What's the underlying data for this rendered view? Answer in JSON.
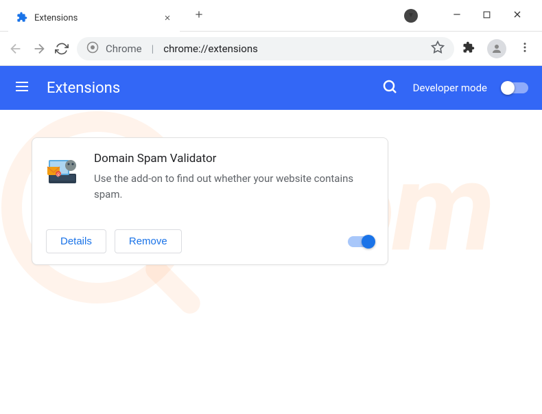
{
  "tab": {
    "title": "Extensions"
  },
  "address": {
    "prefix": "Chrome",
    "url": "chrome://extensions"
  },
  "header": {
    "title": "Extensions",
    "dev_mode_label": "Developer mode"
  },
  "extension": {
    "name": "Domain Spam Validator",
    "description": "Use the add-on to find out whether your website contains spam.",
    "details_label": "Details",
    "remove_label": "Remove",
    "enabled": true
  }
}
